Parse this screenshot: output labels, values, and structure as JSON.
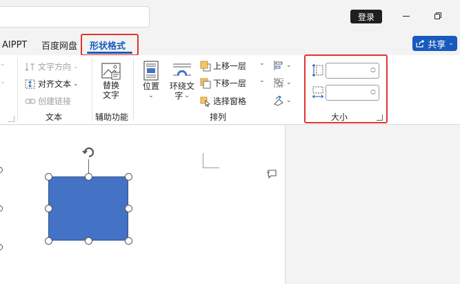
{
  "titlebar": {
    "login_label": "登录",
    "minimize_symbol": "—",
    "restore_symbol": "❐"
  },
  "tabs": [
    {
      "label": "AIPPT"
    },
    {
      "label": "百度网盘"
    },
    {
      "label": "形状格式",
      "active": true
    }
  ],
  "share": {
    "label": "共享"
  },
  "ribbon": {
    "text_group": {
      "text_direction": "文字方向",
      "align_text": "对齐文本",
      "create_link": "创建链接",
      "label": "文本"
    },
    "accessibility_group": {
      "alt_text_line1": "替换",
      "alt_text_line2": "文字",
      "label": "辅助功能"
    },
    "arrange_group": {
      "position": "位置",
      "wrap_text_line1": "环绕文",
      "wrap_text_line2": "字",
      "bring_forward": "上移一层",
      "send_backward": "下移一层",
      "selection_pane": "选择窗格",
      "label": "排列"
    },
    "size_group": {
      "height_value": "",
      "width_value": "",
      "label": "大小"
    }
  },
  "colors": {
    "accent": "#185abd",
    "highlight_border": "#e0322f",
    "shape_fill": "#4472c4"
  }
}
